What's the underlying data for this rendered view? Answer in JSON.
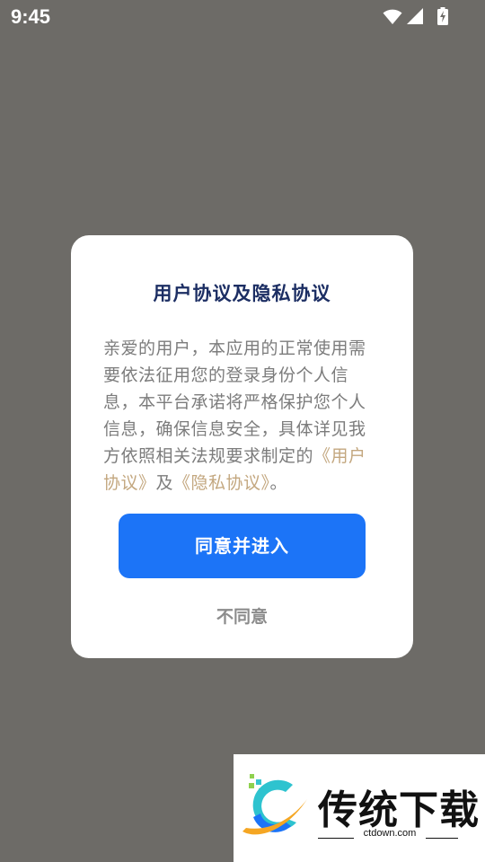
{
  "status_bar": {
    "time": "9:45",
    "icons": [
      "wifi-icon",
      "signal-icon",
      "battery-charging-icon"
    ]
  },
  "dialog": {
    "title": "用户协议及隐私协议",
    "body_text": "亲爱的用户，本应用的正常使用需要依法征用您的登录身份个人信息，本平台承诺将严格保护您个人信息，确保信息安全，具体详见我方依照相关法规要求制定的",
    "link_user_agreement": "《用户协议》",
    "conjunction": "及",
    "link_privacy_agreement": "《隐私协议》",
    "period": "。",
    "agree_label": "同意并进入",
    "disagree_label": "不同意"
  },
  "watermark": {
    "name": "传统下载",
    "url": "ctdown.com"
  },
  "colors": {
    "overlay_background": "#6d6b67",
    "dialog_background": "#ffffff",
    "title": "#1c2e63",
    "body_text": "#7c7c7c",
    "link": "#c3a77f",
    "primary_button": "#1c74f7",
    "secondary_text": "#8c8c8c"
  }
}
